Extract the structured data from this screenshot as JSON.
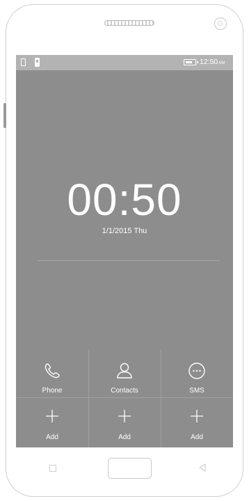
{
  "status_bar": {
    "time": "12:50",
    "ampm": "AM"
  },
  "lock_screen": {
    "clock": "00:50",
    "date": "1/1/2015  Thu"
  },
  "shortcuts": [
    {
      "label": "Phone",
      "icon": "phone-icon"
    },
    {
      "label": "Contacts",
      "icon": "contacts-icon"
    },
    {
      "label": "SMS",
      "icon": "sms-icon"
    }
  ],
  "add_slots": [
    {
      "label": "Add",
      "icon": "plus-icon"
    },
    {
      "label": "Add",
      "icon": "plus-icon"
    },
    {
      "label": "Add",
      "icon": "plus-icon"
    }
  ],
  "colors": {
    "screen_background": "#8d8d8d",
    "status_bar": "#b3b3b3",
    "text": "#ffffff",
    "frame": "#cfcfcf"
  }
}
